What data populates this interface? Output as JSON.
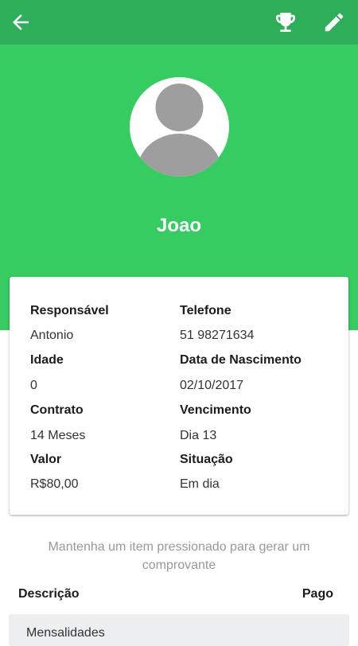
{
  "header": {
    "back_icon": "arrow-left-icon",
    "trophy_icon": "trophy-icon",
    "edit_icon": "pencil-icon"
  },
  "colors": {
    "topbar": "#2fae5a",
    "hero": "#36cc62",
    "avatar_gray": "#9e9e9e"
  },
  "profile": {
    "name": "Joao"
  },
  "details": {
    "responsavel_label": "Responsável",
    "responsavel_value": "Antonio",
    "telefone_label": "Telefone",
    "telefone_value": "51 98271634",
    "idade_label": "Idade",
    "idade_value": "0",
    "nascimento_label": "Data de Nascimento",
    "nascimento_value": "02/10/2017",
    "contrato_label": "Contrato",
    "contrato_value": "14 Meses",
    "vencimento_label": "Vencimento",
    "vencimento_value": "Dia 13",
    "valor_label": "Valor",
    "valor_value": "R$80,00",
    "situacao_label": "Situação",
    "situacao_value": "Em dia"
  },
  "hint": "Mantenha um item pressionado para gerar um comprovante",
  "table": {
    "col_descricao": "Descrição",
    "col_pago": "Pago",
    "rows": [
      {
        "descricao": "Mensalidades"
      }
    ]
  }
}
